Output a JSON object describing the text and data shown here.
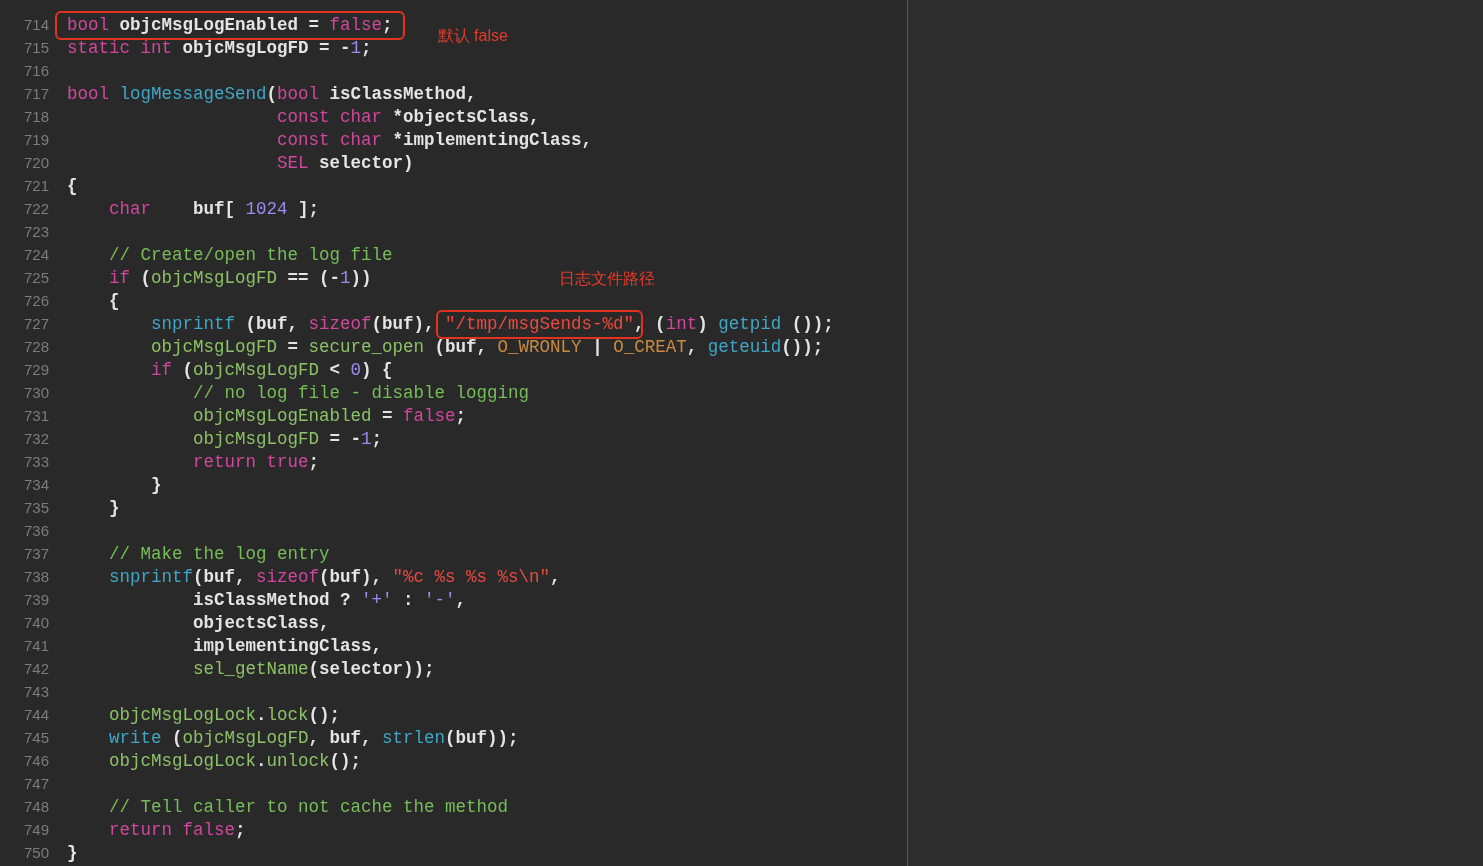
{
  "editor": {
    "lines": [
      {
        "number": "714",
        "tokens": [
          {
            "text": "bool",
            "kind": "keyword",
            "boxed": true
          },
          {
            "text": " objcMsgLogEnabled = ",
            "kind": "plain",
            "boxed": true
          },
          {
            "text": "false",
            "kind": "keyword",
            "boxed": true
          },
          {
            "text": ";",
            "kind": "plain",
            "boxed": true
          }
        ],
        "note": "默认 false"
      },
      {
        "number": "715",
        "tokens": [
          {
            "text": "static int",
            "kind": "keyword"
          },
          {
            "text": " objcMsgLogFD = -",
            "kind": "plain"
          },
          {
            "text": "1",
            "kind": "number"
          },
          {
            "text": ";",
            "kind": "plain"
          }
        ]
      },
      {
        "number": "716"
      },
      {
        "number": "717",
        "tokens": [
          {
            "text": "bool ",
            "kind": "keyword"
          },
          {
            "text": "logMessageSend",
            "kind": "func"
          },
          {
            "text": "(",
            "kind": "plain"
          },
          {
            "text": "bool",
            "kind": "keyword"
          },
          {
            "text": " isClassMethod,",
            "kind": "plain"
          }
        ]
      },
      {
        "number": "718",
        "tokens": [
          {
            "text": "                    const char",
            "kind": "keyword"
          },
          {
            "text": " *objectsClass,",
            "kind": "plain"
          }
        ]
      },
      {
        "number": "719",
        "tokens": [
          {
            "text": "                    const char",
            "kind": "keyword"
          },
          {
            "text": " *implementingClass,",
            "kind": "plain"
          }
        ]
      },
      {
        "number": "720",
        "tokens": [
          {
            "text": "                    SEL",
            "kind": "keyword"
          },
          {
            "text": " selector)",
            "kind": "plain"
          }
        ]
      },
      {
        "number": "721",
        "tokens": [
          {
            "text": "{",
            "kind": "plain"
          }
        ]
      },
      {
        "number": "722",
        "tokens": [
          {
            "text": "    char",
            "kind": "keyword"
          },
          {
            "text": "    buf[ ",
            "kind": "plain"
          },
          {
            "text": "1024",
            "kind": "number"
          },
          {
            "text": " ];",
            "kind": "plain"
          }
        ]
      },
      {
        "number": "723"
      },
      {
        "number": "724",
        "tokens": [
          {
            "text": "    // Create/open the log file",
            "kind": "comment"
          }
        ]
      },
      {
        "number": "725",
        "tokens": [
          {
            "text": "    if",
            "kind": "keyword"
          },
          {
            "text": " (",
            "kind": "plain"
          },
          {
            "text": "objcMsgLogFD",
            "kind": "ident"
          },
          {
            "text": " == (-",
            "kind": "plain"
          },
          {
            "text": "1",
            "kind": "number"
          },
          {
            "text": "))",
            "kind": "plain"
          }
        ],
        "note": "日志文件路径"
      },
      {
        "number": "726",
        "tokens": [
          {
            "text": "    {",
            "kind": "plain"
          }
        ]
      },
      {
        "number": "727",
        "tokens": [
          {
            "text": "        snprintf",
            "kind": "func"
          },
          {
            "text": " (buf, ",
            "kind": "plain"
          },
          {
            "text": "sizeof",
            "kind": "keyword"
          },
          {
            "text": "(buf), ",
            "kind": "plain"
          },
          {
            "text": "\"/tmp/msgSends-%d\"",
            "kind": "string",
            "boxed": true
          },
          {
            "text": ", (",
            "kind": "plain"
          },
          {
            "text": "int",
            "kind": "keyword"
          },
          {
            "text": ") ",
            "kind": "plain"
          },
          {
            "text": "getpid",
            "kind": "func"
          },
          {
            "text": " ());",
            "kind": "plain"
          }
        ]
      },
      {
        "number": "728",
        "tokens": [
          {
            "text": "        objcMsgLogFD",
            "kind": "ident"
          },
          {
            "text": " = ",
            "kind": "plain"
          },
          {
            "text": "secure_open",
            "kind": "ident"
          },
          {
            "text": " (buf, ",
            "kind": "plain"
          },
          {
            "text": "O_WRONLY",
            "kind": "macro"
          },
          {
            "text": " | ",
            "kind": "plain"
          },
          {
            "text": "O_CREAT",
            "kind": "macro"
          },
          {
            "text": ", ",
            "kind": "plain"
          },
          {
            "text": "geteuid",
            "kind": "func"
          },
          {
            "text": "());",
            "kind": "plain"
          }
        ]
      },
      {
        "number": "729",
        "tokens": [
          {
            "text": "        if",
            "kind": "keyword"
          },
          {
            "text": " (",
            "kind": "plain"
          },
          {
            "text": "objcMsgLogFD",
            "kind": "ident"
          },
          {
            "text": " < ",
            "kind": "plain"
          },
          {
            "text": "0",
            "kind": "number"
          },
          {
            "text": ") {",
            "kind": "plain"
          }
        ]
      },
      {
        "number": "730",
        "tokens": [
          {
            "text": "            // no log file - disable logging",
            "kind": "comment"
          }
        ]
      },
      {
        "number": "731",
        "tokens": [
          {
            "text": "            objcMsgLogEnabled",
            "kind": "ident"
          },
          {
            "text": " = ",
            "kind": "plain"
          },
          {
            "text": "false",
            "kind": "keyword"
          },
          {
            "text": ";",
            "kind": "plain"
          }
        ]
      },
      {
        "number": "732",
        "tokens": [
          {
            "text": "            objcMsgLogFD",
            "kind": "ident"
          },
          {
            "text": " = -",
            "kind": "plain"
          },
          {
            "text": "1",
            "kind": "number"
          },
          {
            "text": ";",
            "kind": "plain"
          }
        ]
      },
      {
        "number": "733",
        "tokens": [
          {
            "text": "            return true",
            "kind": "keyword"
          },
          {
            "text": ";",
            "kind": "plain"
          }
        ]
      },
      {
        "number": "734",
        "tokens": [
          {
            "text": "        }",
            "kind": "plain"
          }
        ]
      },
      {
        "number": "735",
        "tokens": [
          {
            "text": "    }",
            "kind": "plain"
          }
        ]
      },
      {
        "number": "736"
      },
      {
        "number": "737",
        "tokens": [
          {
            "text": "    // Make the log entry",
            "kind": "comment"
          }
        ]
      },
      {
        "number": "738",
        "tokens": [
          {
            "text": "    snprintf",
            "kind": "func"
          },
          {
            "text": "(buf, ",
            "kind": "plain"
          },
          {
            "text": "sizeof",
            "kind": "keyword"
          },
          {
            "text": "(buf), ",
            "kind": "plain"
          },
          {
            "text": "\"%c %s %s %s\\n\"",
            "kind": "string"
          },
          {
            "text": ",",
            "kind": "plain"
          }
        ]
      },
      {
        "number": "739",
        "tokens": [
          {
            "text": "            isClassMethod ? ",
            "kind": "plain"
          },
          {
            "text": "'+'",
            "kind": "number"
          },
          {
            "text": " : ",
            "kind": "plain"
          },
          {
            "text": "'-'",
            "kind": "number"
          },
          {
            "text": ",",
            "kind": "plain"
          }
        ]
      },
      {
        "number": "740",
        "tokens": [
          {
            "text": "            objectsClass,",
            "kind": "plain"
          }
        ]
      },
      {
        "number": "741",
        "tokens": [
          {
            "text": "            implementingClass,",
            "kind": "plain"
          }
        ]
      },
      {
        "number": "742",
        "tokens": [
          {
            "text": "            sel_getName",
            "kind": "ident"
          },
          {
            "text": "(selector));",
            "kind": "plain"
          }
        ]
      },
      {
        "number": "743"
      },
      {
        "number": "744",
        "tokens": [
          {
            "text": "    objcMsgLogLock",
            "kind": "ident"
          },
          {
            "text": ".",
            "kind": "plain"
          },
          {
            "text": "lock",
            "kind": "ident"
          },
          {
            "text": "();",
            "kind": "plain"
          }
        ]
      },
      {
        "number": "745",
        "tokens": [
          {
            "text": "    write",
            "kind": "func"
          },
          {
            "text": " (",
            "kind": "plain"
          },
          {
            "text": "objcMsgLogFD",
            "kind": "ident"
          },
          {
            "text": ", buf, ",
            "kind": "plain"
          },
          {
            "text": "strlen",
            "kind": "func"
          },
          {
            "text": "(buf));",
            "kind": "plain"
          }
        ]
      },
      {
        "number": "746",
        "tokens": [
          {
            "text": "    objcMsgLogLock",
            "kind": "ident"
          },
          {
            "text": ".",
            "kind": "plain"
          },
          {
            "text": "unlock",
            "kind": "ident"
          },
          {
            "text": "();",
            "kind": "plain"
          }
        ]
      },
      {
        "number": "747"
      },
      {
        "number": "748",
        "tokens": [
          {
            "text": "    // Tell caller to not cache the method",
            "kind": "comment"
          }
        ]
      },
      {
        "number": "749",
        "tokens": [
          {
            "text": "    return false",
            "kind": "keyword"
          },
          {
            "text": ";",
            "kind": "plain"
          }
        ]
      },
      {
        "number": "750",
        "tokens": [
          {
            "text": "}",
            "kind": "plain"
          }
        ]
      }
    ]
  }
}
